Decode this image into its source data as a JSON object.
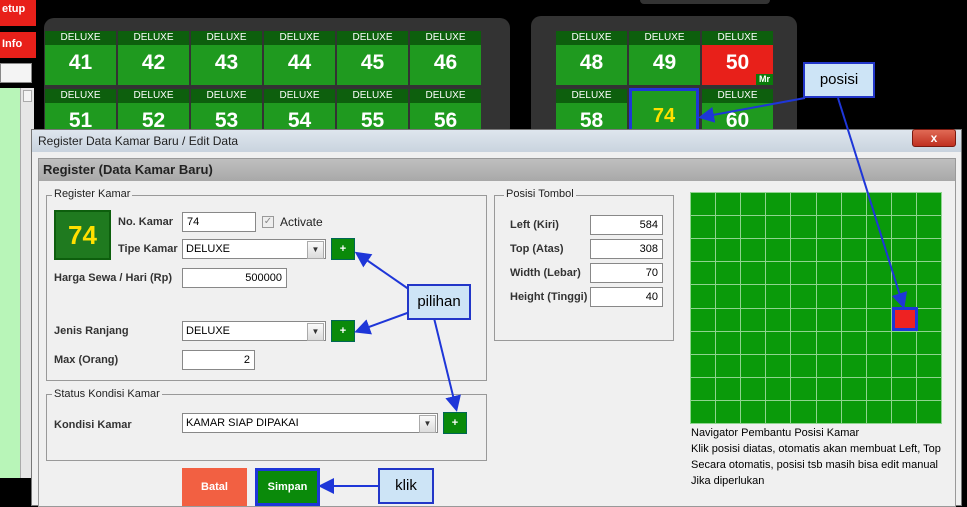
{
  "left_strip": {
    "setup_label": "etup",
    "info_label": "Info"
  },
  "board": {
    "row1": [
      {
        "cat": "DELUXE",
        "num": "41"
      },
      {
        "cat": "DELUXE",
        "num": "42"
      },
      {
        "cat": "DELUXE",
        "num": "43"
      },
      {
        "cat": "DELUXE",
        "num": "44"
      },
      {
        "cat": "DELUXE",
        "num": "45"
      },
      {
        "cat": "DELUXE",
        "num": "46"
      }
    ],
    "row2": [
      {
        "cat": "DELUXE",
        "num": "51"
      },
      {
        "cat": "DELUXE",
        "num": "52"
      },
      {
        "cat": "DELUXE",
        "num": "53"
      },
      {
        "cat": "DELUXE",
        "num": "54"
      },
      {
        "cat": "DELUXE",
        "num": "55"
      },
      {
        "cat": "DELUXE",
        "num": "56"
      }
    ],
    "right_row1": [
      {
        "cat": "DELUXE",
        "num": "48"
      },
      {
        "cat": "DELUXE",
        "num": "49"
      },
      {
        "cat": "DELUXE",
        "num": "50",
        "badge": "Mr"
      }
    ],
    "right_row2": [
      {
        "cat": "DELUXE",
        "num": "58"
      },
      {
        "cat": "",
        "num": "74"
      },
      {
        "cat": "DELUXE",
        "num": "60"
      }
    ]
  },
  "dialog": {
    "title": "Register Data Kamar Baru / Edit Data",
    "close": "x",
    "header": "Register (Data Kamar Baru)",
    "register_group": "Register Kamar",
    "preview_number": "74",
    "no_kamar_label": "No. Kamar",
    "no_kamar_value": "74",
    "activate_label": "Activate",
    "activate_checked": true,
    "tipe_label": "Tipe Kamar",
    "tipe_value": "DELUXE",
    "harga_label": "Harga Sewa / Hari (Rp)",
    "harga_value": "500000",
    "ranjang_label": "Jenis Ranjang",
    "ranjang_value": "DELUXE",
    "max_label": "Max (Orang)",
    "max_value": "2",
    "plus": "+",
    "status_group": "Status Kondisi Kamar",
    "kondisi_label": "Kondisi Kamar",
    "kondisi_value": "KAMAR SIAP DIPAKAI",
    "posisi_group": "Posisi Tombol",
    "left_label": "Left (Kiri)",
    "left_value": "584",
    "top_label": "Top (Atas)",
    "top_value": "308",
    "width_label": "Width (Lebar)",
    "width_value": "70",
    "height_label": "Height (Tinggi)",
    "height_value": "40",
    "navigator_notes": [
      "Navigator Pembantu Posisi Kamar",
      "Klik posisi diatas, otomatis akan membuat  Left, Top",
      "Secara otomatis, posisi tsb masih bisa edit manual",
      "Jika diperlukan"
    ],
    "batal": "Batal",
    "simpan": "Simpan"
  },
  "callouts": {
    "posisi": "posisi",
    "pilihan": "pilihan",
    "klik": "klik"
  },
  "colors": {
    "room_green": "#1f9a1f",
    "room_red": "#e8201a",
    "highlight": "#1e36d8",
    "callout_bg": "#cde4f6"
  }
}
